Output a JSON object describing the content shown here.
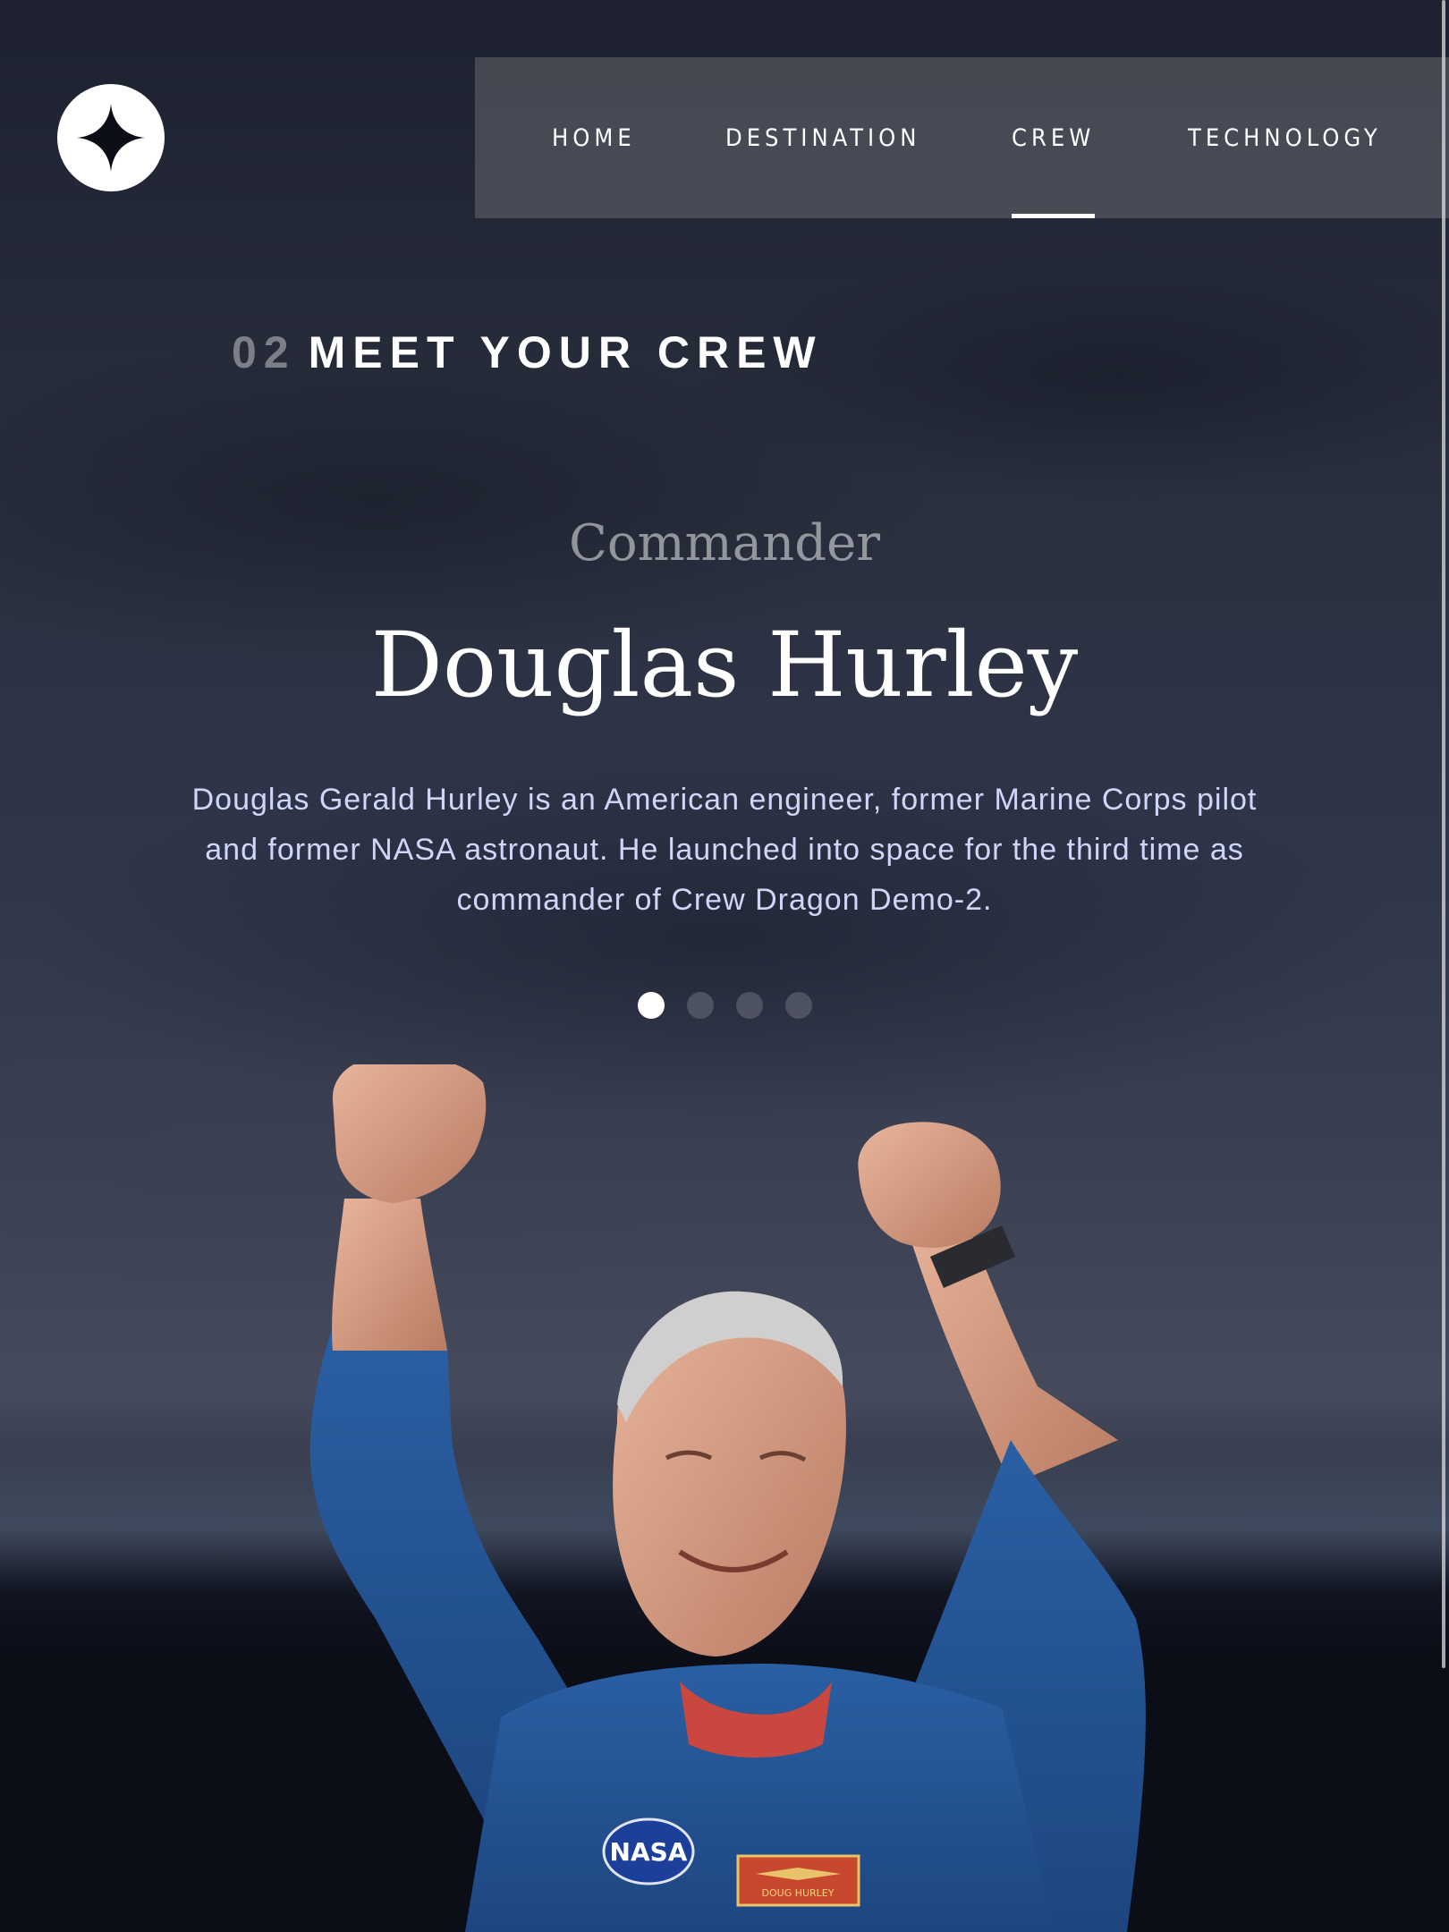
{
  "nav": {
    "items": [
      {
        "label": "HOME"
      },
      {
        "label": "DESTINATION"
      },
      {
        "label": "CREW"
      },
      {
        "label": "TECHNOLOGY"
      }
    ],
    "active_index": 2
  },
  "page": {
    "number": "02",
    "title": "MEET YOUR CREW"
  },
  "crew": {
    "role": "Commander",
    "name": "Douglas Hurley",
    "bio": "Douglas Gerald Hurley is an American engineer, former Marine Corps pilot and former NASA astronaut. He launched into space for the third time as commander of Crew Dragon Demo-2.",
    "slides_total": 4,
    "active_slide": 1,
    "photo": {
      "patch_text": "NASA",
      "name_tag": "DOUG HURLEY"
    }
  },
  "colors": {
    "background": "#0b0d17",
    "text": "#ffffff",
    "bio_text": "#d0d6f9",
    "nav_bg": "rgba(151,151,151,0.32)"
  },
  "icons": {
    "logo": "four-point-star-logo"
  }
}
